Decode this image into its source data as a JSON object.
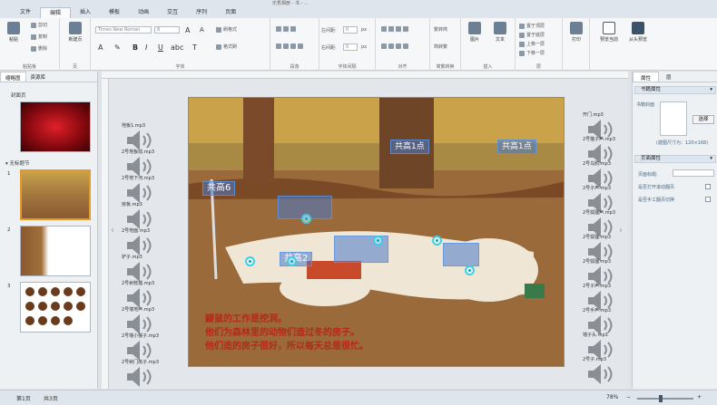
{
  "window": {
    "title": "乐秀相册 - 书 - ..."
  },
  "menu_tabs": [
    "文件",
    "编辑",
    "插入",
    "模板",
    "动画",
    "交互",
    "序列",
    "页面"
  ],
  "active_tab": "编辑",
  "ribbon": {
    "paste": "粘贴",
    "cut": "剪切",
    "copy": "复制",
    "delete": "删除",
    "clipboard_group": "粘贴板",
    "new_page": "新建页",
    "page_group": "页",
    "font_name": "Times New Roman",
    "font_size": "8",
    "brush_format": "刷格式",
    "clear_format": "格式刷",
    "font_group": "字体",
    "para_group": "段落",
    "spacing_left": "左间距:",
    "spacing_right": "右间距:",
    "spacing_value": "0",
    "spacing_unit": "px",
    "char_spacing_group": "字体间隔",
    "align_group": "对齐",
    "trad_to_simp": "繁转简",
    "simp_to_trad": "简转繁",
    "convert_group": "简繁转换",
    "picture": "图片",
    "text": "文本",
    "insert_group": "插入",
    "to_top": "置于顶层",
    "to_bottom": "置于底层",
    "up_one": "上移一层",
    "down_one": "下移一层",
    "layer_group": "层",
    "print": "打印",
    "preview_current": "预览当前",
    "preview_start": "从头预览"
  },
  "left_panel": {
    "tabs": [
      "缩略图",
      "资源库"
    ],
    "cover_label": "封面页",
    "section_label": "无标题节",
    "slide_numbers": [
      "1",
      "2",
      "3"
    ]
  },
  "slide": {
    "hotspot_boxes": [
      "共高1点",
      "共高1点",
      "共高6",
      "共高2"
    ],
    "story": [
      "鼹鼠的工作是挖洞。",
      "他们为森林里的动物们造过冬的房子。",
      "他们造的房子很好，所以每天总是很忙。"
    ]
  },
  "sounds_left": [
    "地板1.mp3",
    "2号地板动.mp3",
    "2号地下河.mp3",
    "房板.mp3",
    "2号地面.mp3",
    "铲子.mp3",
    "2号树枝摇.mp3",
    "2号墙地声.mp3",
    "2号墙小猴子.mp3",
    "2号树门房子.mp3"
  ],
  "sounds_right": [
    "开门.mp3",
    "2号猫子声.mp3",
    "2号乌鸦.mp3",
    "2号子声.mp3",
    "2号狐狸声.mp3",
    "2号狐狸.mp3",
    "2号狐狸.mp3",
    "2号子声.mp3",
    "2号手声.mp3",
    "墙子头.mp3",
    "2号子.mp3"
  ],
  "right_panel": {
    "tabs": [
      "属性",
      "层"
    ],
    "book_attr": "书籍属性",
    "cover_label": "书籍封面",
    "select_btn": "选择",
    "size_hint": "(建图尺寸为：120×168)",
    "page_attr": "页面属性",
    "page_title_label": "页面标题:",
    "opt1": "是否打开滚动翻页",
    "opt2": "是否手工翻页切换"
  },
  "status": {
    "page": "第1页",
    "total": "共3页",
    "zoom": "78%"
  },
  "colors": {
    "accent": "#2b5f9e",
    "story_text": "#b42a18",
    "hotspot": "#3cd0e8"
  }
}
